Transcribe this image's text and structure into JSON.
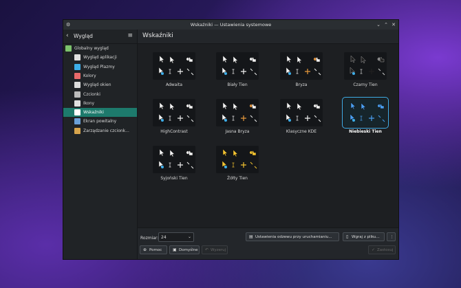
{
  "window": {
    "title": "Wskaźniki — Ustawienia systemowe"
  },
  "sidebar": {
    "back_label": "Wygląd",
    "items": [
      {
        "label": "Globalny wygląd",
        "icon": "globe-theme-icon",
        "color": "#7cc36c"
      },
      {
        "label": "Wygląd aplikacji",
        "icon": "brush-icon",
        "color": "#e0e0e0"
      },
      {
        "label": "Wygląd Plazmy",
        "icon": "plasma-icon",
        "color": "#3daee9"
      },
      {
        "label": "Kolory",
        "icon": "palette-icon",
        "color": "#e86a6a"
      },
      {
        "label": "Wygląd okien",
        "icon": "window-icon",
        "color": "#dcdcdc"
      },
      {
        "label": "Czcionki",
        "icon": "font-icon",
        "color": "#bbbbbb"
      },
      {
        "label": "Ikony",
        "icon": "icons-icon",
        "color": "#e0e0e0"
      },
      {
        "label": "Wskaźniki",
        "icon": "cursor-icon",
        "color": "#ffffff"
      },
      {
        "label": "Ekran powitalny",
        "icon": "splash-icon",
        "color": "#6aa0d8"
      },
      {
        "label": "Zarządzanie czcionk...",
        "icon": "font-manager-icon",
        "color": "#d6a44c"
      }
    ],
    "active_index": 7
  },
  "main": {
    "title": "Wskaźniki",
    "themes": [
      {
        "name": "Adwaita",
        "style": "white"
      },
      {
        "name": "Biały Tien",
        "style": "white"
      },
      {
        "name": "Bryza",
        "style": "breeze"
      },
      {
        "name": "Czarny Tien",
        "style": "dark"
      },
      {
        "name": "HighContrast",
        "style": "white"
      },
      {
        "name": "Jasna Bryza",
        "style": "breeze"
      },
      {
        "name": "Klasyczne KDE",
        "style": "white"
      },
      {
        "name": "Niebieski Tien",
        "style": "blue"
      },
      {
        "name": "Syjoński Tien",
        "style": "white"
      },
      {
        "name": "Żółty Tien",
        "style": "yellow"
      }
    ],
    "selected_index": 7
  },
  "bottom": {
    "size_label": "Rozmiar:",
    "size_value": "24",
    "launch_feedback_label": "Ustawienia odzewu przy uruchamianiu...",
    "install_label": "Wgraj z pliku...",
    "more_label": "⋮",
    "help_label": "Pomoc",
    "defaults_label": "Domyślne",
    "reset_label": "Wyzeruj",
    "apply_label": "Zastosuj"
  }
}
